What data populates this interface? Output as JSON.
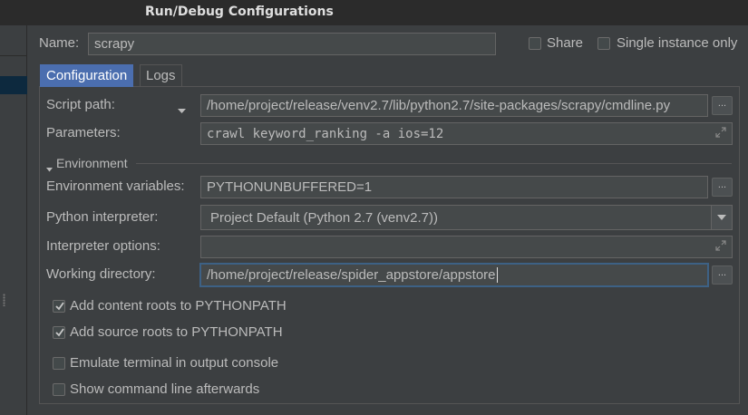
{
  "window": {
    "title": "Run/Debug Configurations"
  },
  "header": {
    "name_label": "Name:",
    "name_value": "scrapy",
    "share_label": "Share",
    "single_instance_label": "Single instance only"
  },
  "tabs": [
    {
      "label": "Configuration",
      "active": true
    },
    {
      "label": "Logs",
      "active": false
    }
  ],
  "form": {
    "script_path_label": "Script path:",
    "script_path_value": "/home/project/release/venv2.7/lib/python2.7/site-packages/scrapy/cmdline.py",
    "parameters_label": "Parameters:",
    "parameters_value": "crawl keyword_ranking -a ios=12",
    "environment_header": "Environment",
    "env_vars_label": "Environment variables:",
    "env_vars_value": "PYTHONUNBUFFERED=1",
    "interpreter_label": "Python interpreter:",
    "interpreter_value": "Project Default (Python 2.7 (venv2.7))",
    "interp_options_label": "Interpreter options:",
    "interp_options_value": "",
    "working_dir_label": "Working directory:",
    "working_dir_value": "/home/project/release/spider_appstore/appstore",
    "browse_label": "...",
    "options": [
      {
        "label": "Add content roots to PYTHONPATH",
        "checked": true
      },
      {
        "label": "Add source roots to PYTHONPATH",
        "checked": true
      },
      {
        "label": "Emulate terminal in output console",
        "checked": false
      },
      {
        "label": "Show command line afterwards",
        "checked": false
      }
    ]
  },
  "icons": [
    "triangle-down-icon",
    "expand-icon",
    "check-icon",
    "combo-arrow-icon"
  ],
  "colors": {
    "accent": "#4b6eaf",
    "background": "#3c3f41",
    "field": "#45494a"
  }
}
